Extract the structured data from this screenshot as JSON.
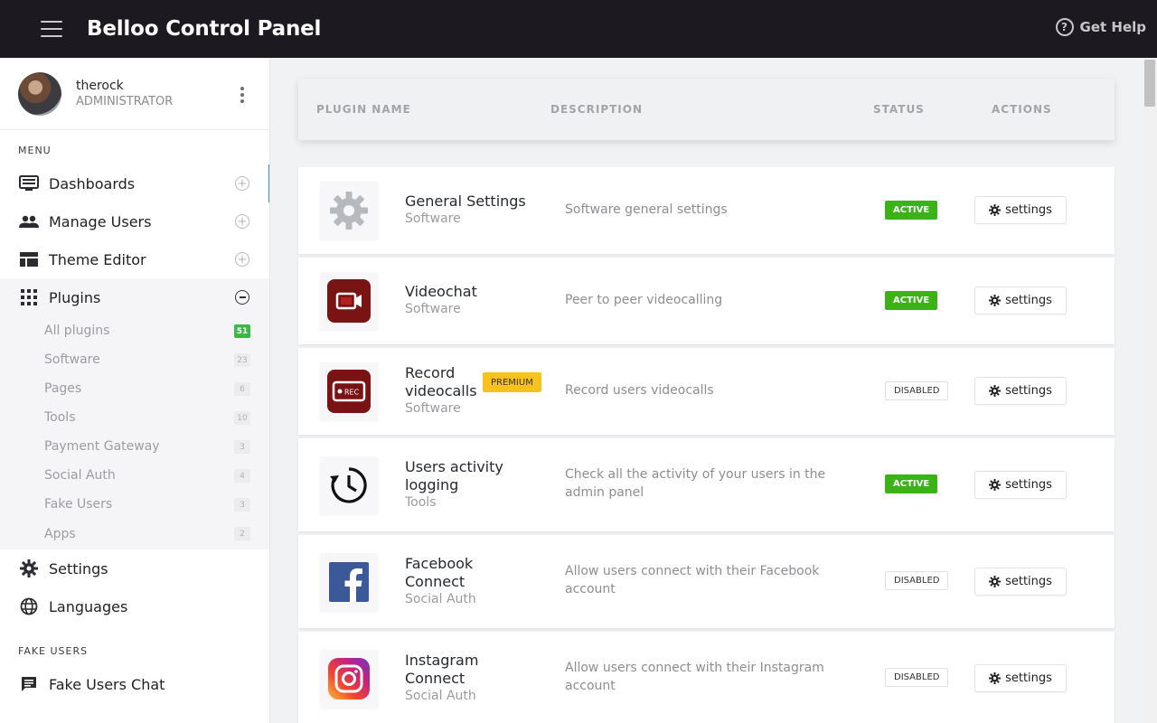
{
  "header": {
    "title": "Belloo Control Panel",
    "help_label": "Get Help"
  },
  "user": {
    "name": "therock",
    "role": "ADMINISTRATOR"
  },
  "sidebar": {
    "menu_label": "MENU",
    "items": [
      {
        "label": "Dashboards",
        "icon": "dashboard-icon"
      },
      {
        "label": "Manage Users",
        "icon": "users-icon"
      },
      {
        "label": "Theme Editor",
        "icon": "theme-icon"
      },
      {
        "label": "Plugins",
        "icon": "grid-icon"
      }
    ],
    "plugin_subitems": [
      {
        "label": "All plugins",
        "count": "51"
      },
      {
        "label": "Software",
        "count": "23"
      },
      {
        "label": "Pages",
        "count": "6"
      },
      {
        "label": "Tools",
        "count": "10"
      },
      {
        "label": "Payment Gateway",
        "count": "3"
      },
      {
        "label": "Social Auth",
        "count": "4"
      },
      {
        "label": "Fake Users",
        "count": "3"
      },
      {
        "label": "Apps",
        "count": "2"
      }
    ],
    "bottom_items": [
      {
        "label": "Settings",
        "icon": "gear-icon"
      },
      {
        "label": "Languages",
        "icon": "globe-icon"
      }
    ],
    "fake_users_label": "FAKE USERS",
    "fake_items": [
      {
        "label": "Fake Users Chat",
        "icon": "chat-icon"
      }
    ]
  },
  "table": {
    "columns": [
      "PLUGIN NAME",
      "DESCRIPTION",
      "STATUS",
      "ACTIONS"
    ],
    "rows": [
      {
        "name": "General Settings",
        "category": "Software",
        "description": "Software general settings",
        "status": "ACTIVE",
        "action": "settings",
        "icon": "gear-icon"
      },
      {
        "name": "Videochat",
        "category": "Software",
        "description": "Peer to peer videocalling",
        "status": "ACTIVE",
        "action": "settings",
        "icon": "videochat-icon"
      },
      {
        "name": "Record videocalls",
        "category": "Software",
        "description": "Record users videocalls",
        "status": "DISABLED",
        "action": "settings",
        "badge": "PREMIUM",
        "icon": "rec-icon"
      },
      {
        "name": "Users activity logging",
        "category": "Tools",
        "description": "Check all the activity of your users in the admin panel",
        "status": "ACTIVE",
        "action": "settings",
        "icon": "history-icon"
      },
      {
        "name": "Facebook Connect",
        "category": "Social Auth",
        "description": "Allow users connect with their Facebook account",
        "status": "DISABLED",
        "action": "settings",
        "icon": "facebook-icon"
      },
      {
        "name": "Instagram Connect",
        "category": "Social Auth",
        "description": "Allow users connect with their Instagram account",
        "status": "DISABLED",
        "action": "settings",
        "icon": "instagram-icon"
      }
    ]
  },
  "colors": {
    "topbar": "#1c1a20",
    "active_green": "#3bb317",
    "premium_yellow": "#f6c21b",
    "count_green": "#3bb84a"
  }
}
